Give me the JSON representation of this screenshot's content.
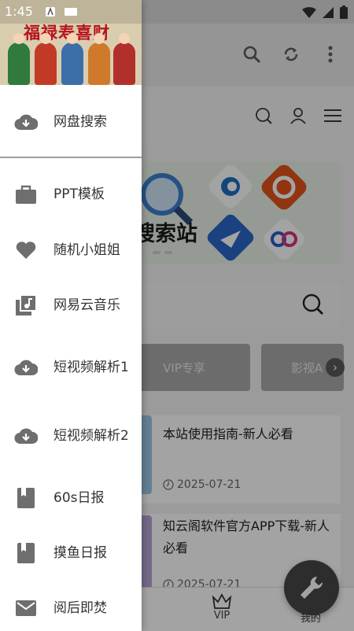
{
  "status_bar": {
    "time": "1:45"
  },
  "drawer": {
    "header_logo_text": "福禄寿喜财",
    "items": [
      {
        "label": "网盘搜索",
        "icon": "cloud-download-icon"
      },
      {
        "label": "PPT模板",
        "icon": "briefcase-icon"
      },
      {
        "label": "随机小姐姐",
        "icon": "heart-icon"
      },
      {
        "label": "网易云音乐",
        "icon": "music-library-icon"
      },
      {
        "label": "短视频解析1",
        "icon": "cloud-download-icon"
      },
      {
        "label": "短视频解析2",
        "icon": "cloud-download-icon"
      },
      {
        "label": "60s日报",
        "icon": "book-icon"
      },
      {
        "label": "摸鱼日报",
        "icon": "book-icon"
      },
      {
        "label": "阅后即焚",
        "icon": "mail-icon"
      }
    ]
  },
  "background": {
    "banner_text": "搜索站",
    "categories": [
      {
        "label": "VIP专享"
      },
      {
        "label": "影视A"
      }
    ],
    "posts": [
      {
        "title": "本站使用指南-新人必看",
        "date": "2025-07-21"
      },
      {
        "title": "知云阁软件官方APP下载-新人必看",
        "date": "2025-07-21"
      }
    ],
    "bottom_nav": {
      "vip_label": "VIP",
      "mine_label": "我的"
    }
  },
  "colors": {
    "scrim": "rgba(0,0,0,0.36)",
    "drawer_bg": "#ffffff",
    "icon_gray": "#6e6e6e",
    "logo_red": "#b8121b"
  }
}
